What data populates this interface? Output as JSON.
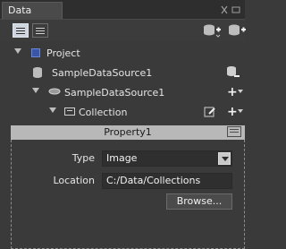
{
  "panel": {
    "tab_title": "Data"
  },
  "tree": {
    "project": {
      "label": "Project"
    },
    "datasource": {
      "label": "SampleDataSource1"
    },
    "datasource_child": {
      "label": "SampleDataSource1",
      "add": "+"
    },
    "collection": {
      "label": "Collection",
      "add": "+"
    }
  },
  "property": {
    "title": "Property1",
    "type_label": "Type",
    "type_value": "Image",
    "location_label": "Location",
    "location_value": "C:/Data/Collections",
    "browse_label": "Browse..."
  }
}
